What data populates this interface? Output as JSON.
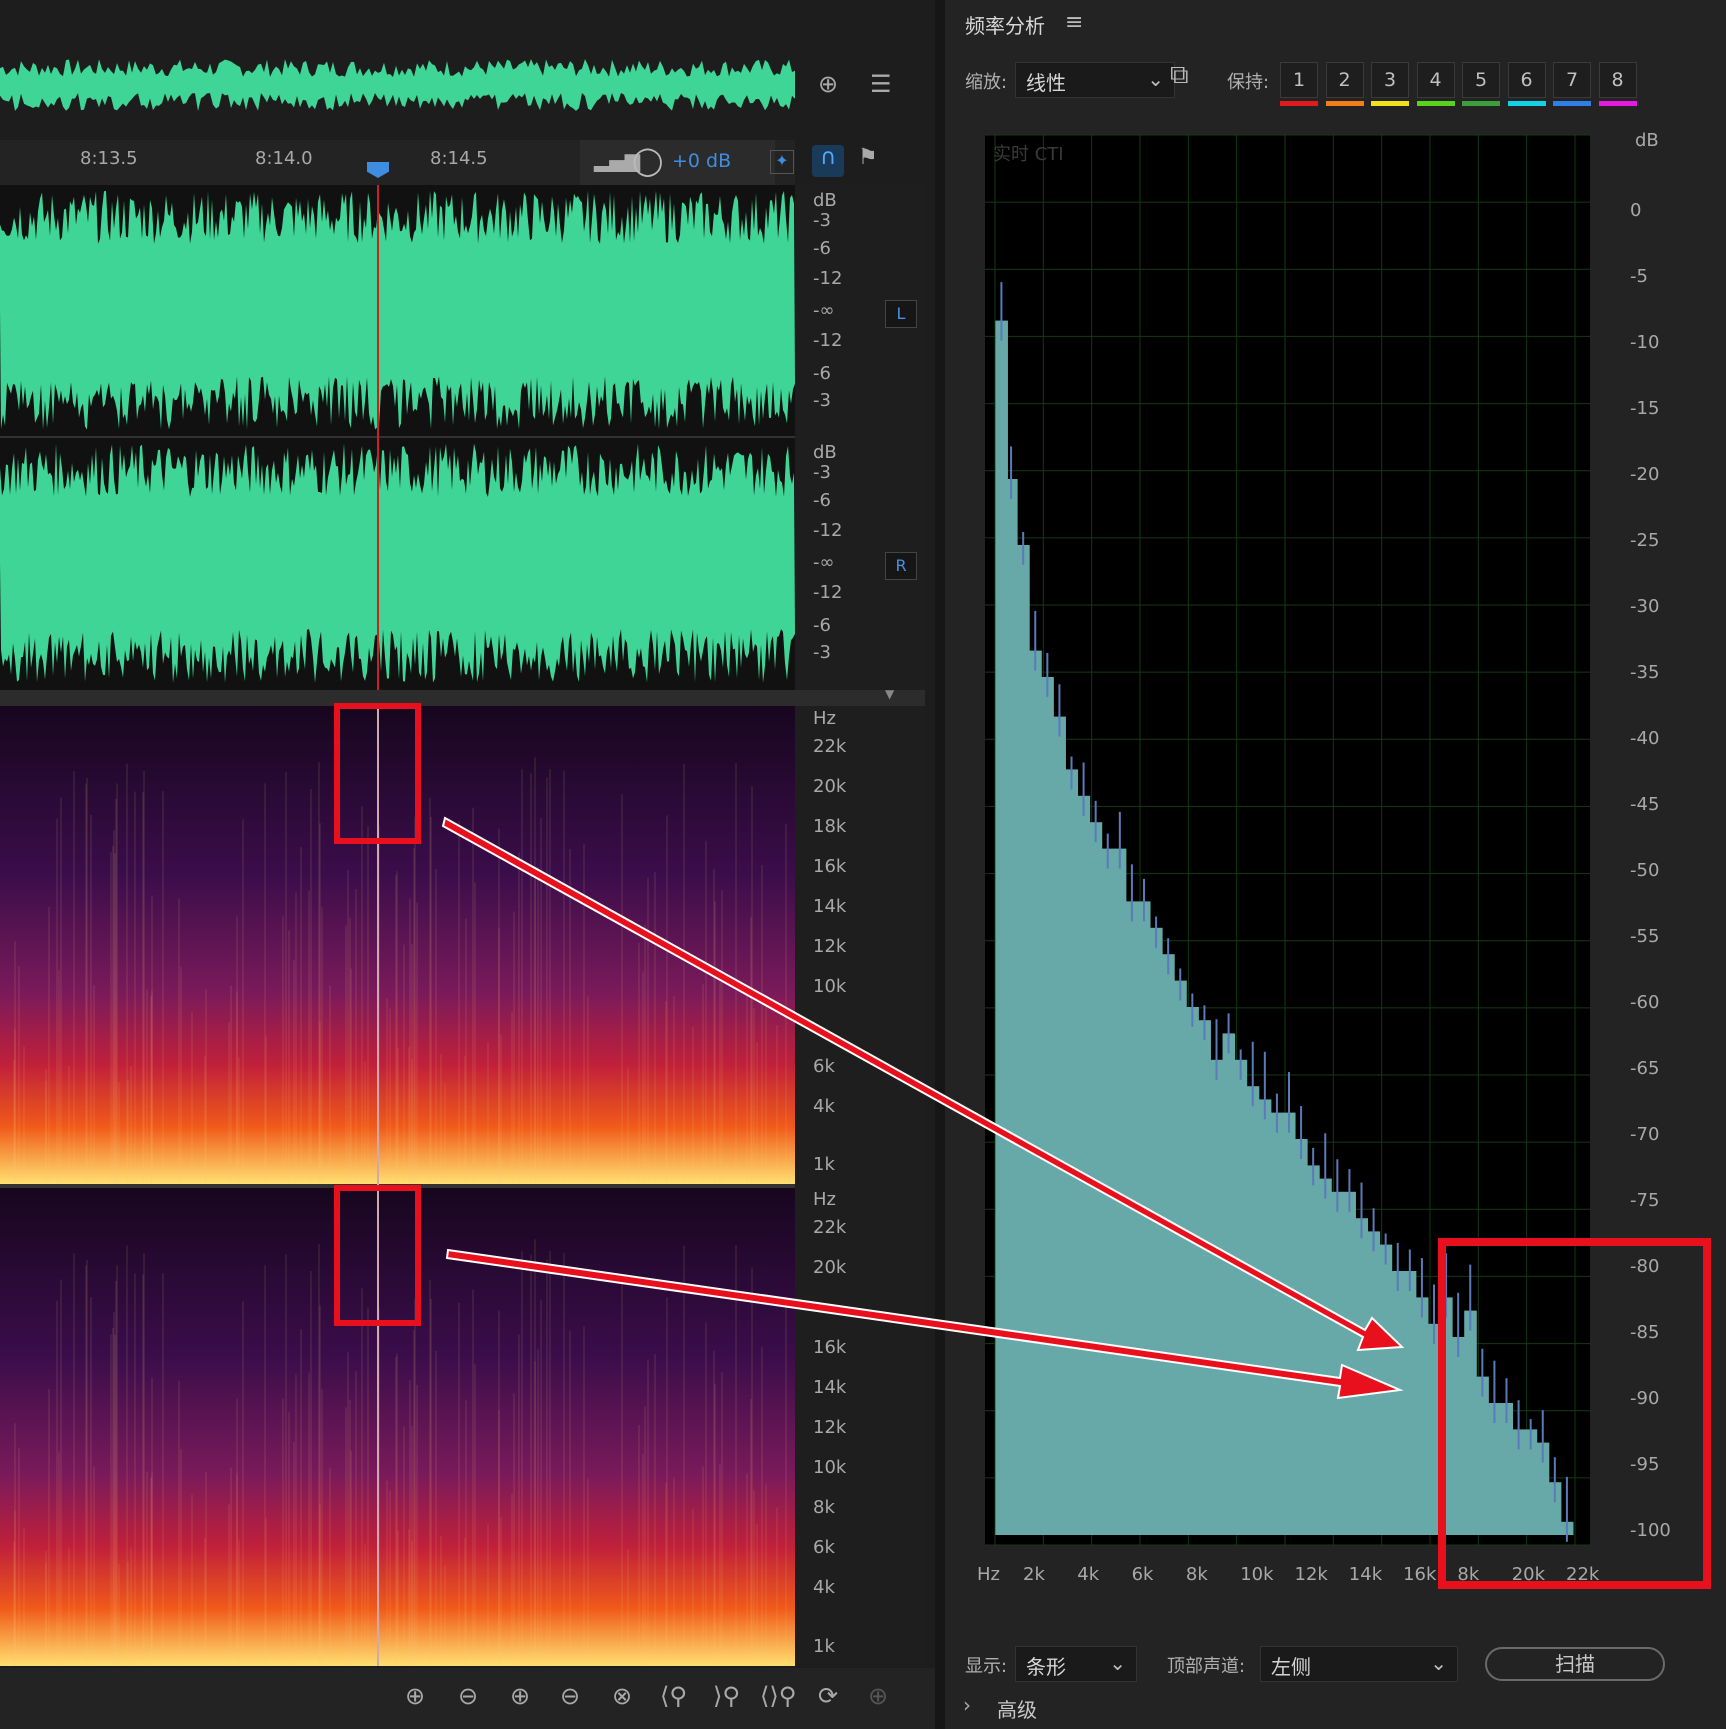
{
  "panel": {
    "title": "频率分析",
    "zoom_label": "缩放:",
    "zoom_value": "线性",
    "hold_label": "保持:",
    "hold_buttons": [
      {
        "label": "1",
        "color": "#e01b1b"
      },
      {
        "label": "2",
        "color": "#f07f1a"
      },
      {
        "label": "3",
        "color": "#efe21c"
      },
      {
        "label": "4",
        "color": "#58d21a"
      },
      {
        "label": "5",
        "color": "#3c9f3c"
      },
      {
        "label": "6",
        "color": "#13d2e6"
      },
      {
        "label": "7",
        "color": "#2f7fe8"
      },
      {
        "label": "8",
        "color": "#e619e0"
      }
    ],
    "graph_caption": "实时 CTI",
    "db_axis": {
      "unit": "dB",
      "labels": [
        "0",
        "-5",
        "-10",
        "-15",
        "-20",
        "-25",
        "-30",
        "-35",
        "-40",
        "-45",
        "-50",
        "-55",
        "-60",
        "-65",
        "-70",
        "-75",
        "-80",
        "-85",
        "-90",
        "-95",
        "-100"
      ]
    },
    "hz_axis": {
      "unit": "Hz",
      "labels": [
        "2k",
        "4k",
        "6k",
        "8k",
        "10k",
        "12k",
        "14k",
        "16k",
        "8k",
        "20k",
        "22k"
      ]
    },
    "display_label": "显示:",
    "display_value": "条形",
    "top_channel_label": "顶部声道:",
    "top_channel_value": "左侧",
    "scan_button": "扫描",
    "advanced_label": "高级",
    "bar_color": "#67a8a8"
  },
  "editor": {
    "timeline": [
      "8:13.5",
      "8:14.0",
      "8:14.5"
    ],
    "gain": "+0 dB",
    "channel_L": "L",
    "channel_R": "R",
    "waveform_db_unit": "dB",
    "waveform_db_labels": [
      "-3",
      "-6",
      "-12",
      "-∞",
      "-12",
      "-6",
      "-3"
    ],
    "spectral_unit": "Hz",
    "spectral_labels_top": [
      "22k",
      "20k",
      "18k",
      "16k",
      "14k",
      "12k",
      "10k",
      "6k",
      "4k",
      "1k"
    ],
    "spectral_labels_bottom": [
      "22k",
      "20k",
      "16k",
      "14k",
      "12k",
      "10k",
      "8k",
      "6k",
      "4k",
      "1k"
    ],
    "waveform_color": "#3fd596",
    "annotation_color": "#e8101c"
  },
  "chart_data": {
    "type": "bar",
    "title": "",
    "xlabel": "Hz",
    "ylabel": "dB",
    "ylim": [
      -100,
      0
    ],
    "xlim": [
      0,
      24000
    ],
    "x": [
      100,
      500,
      1000,
      1500,
      2000,
      2500,
      3000,
      3500,
      4000,
      4500,
      5000,
      5500,
      6000,
      6500,
      7000,
      7500,
      8000,
      8500,
      9000,
      9500,
      10000,
      10500,
      11000,
      11500,
      12000,
      12500,
      13000,
      13500,
      14000,
      14500,
      15000,
      15500,
      16000,
      16500,
      17000,
      17500,
      18000,
      18500,
      19000,
      19500,
      20000,
      20500,
      21000,
      21500,
      22000,
      22500,
      23000,
      23500
    ],
    "values": [
      -8,
      -20,
      -25,
      -33,
      -35,
      -38,
      -42,
      -44,
      -46,
      -48,
      -48,
      -52,
      -52,
      -54,
      -56,
      -58,
      -60,
      -61,
      -64,
      -62,
      -64,
      -66,
      -67,
      -68,
      -68,
      -70,
      -72,
      -73,
      -74,
      -74,
      -76,
      -77,
      -78,
      -80,
      -80,
      -82,
      -84,
      -82,
      -85,
      -83,
      -88,
      -90,
      -90,
      -92,
      -92,
      -93,
      -96,
      -99
    ]
  }
}
